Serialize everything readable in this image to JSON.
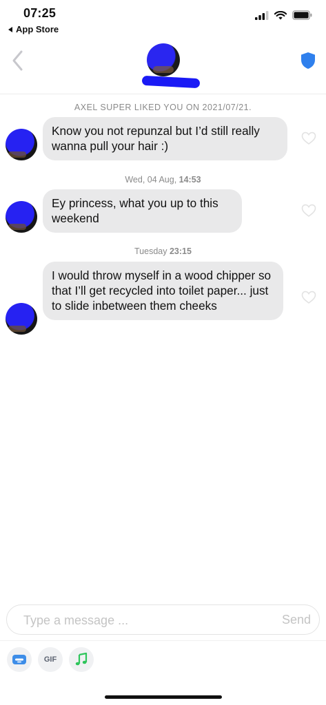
{
  "status_bar": {
    "time": "07:25",
    "back_app": "App Store",
    "icons": [
      "signal-icon",
      "wifi-icon",
      "battery-icon"
    ]
  },
  "header": {
    "back_icon": "chevron-left-icon",
    "verified_icon": "shield-icon",
    "accent_color": "#2f80ed"
  },
  "chat": {
    "super_like_banner": "AXEL SUPER LIKED YOU ON 2021/07/21.",
    "messages": [
      {
        "text": "Know you not repunzal but I’d still really wanna pull your hair :)"
      },
      {
        "day": "Wed, 04 Aug,",
        "time": "14:53",
        "text": "Ey princess, what you up to this weekend"
      },
      {
        "day": "Tuesday",
        "time": "23:15",
        "text": "I would throw myself in a wood chipper so that I’ll get recycled into toilet paper... just to slide inbetween them cheeks"
      }
    ]
  },
  "composer": {
    "placeholder": "Type a message ...",
    "send_label": "Send",
    "gif_label": "GIF",
    "tools": [
      "sticker-icon",
      "gif-icon",
      "music-note-icon"
    ],
    "music_color": "#2ec55b"
  }
}
